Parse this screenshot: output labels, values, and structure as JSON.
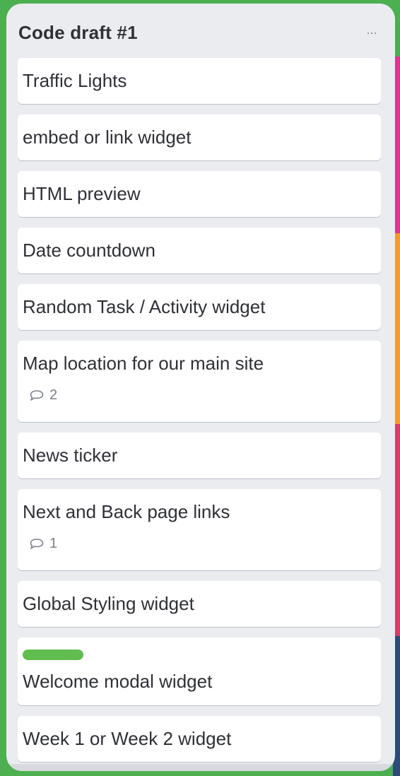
{
  "list": {
    "title": "Code draft #1",
    "menu_icon": "more-horizontal-icon",
    "menu_glyph": "···"
  },
  "cards": [
    {
      "title": "Traffic Lights"
    },
    {
      "title": "embed or link widget"
    },
    {
      "title": "HTML preview"
    },
    {
      "title": "Date countdown"
    },
    {
      "title": "Random Task / Activity widget"
    },
    {
      "title": "Map location for our main site",
      "comments": "2",
      "comment_icon": "comment-icon"
    },
    {
      "title": "News ticker"
    },
    {
      "title": "Next and Back page links",
      "comments": "1",
      "comment_icon": "comment-icon"
    },
    {
      "title": "Global Styling widget"
    },
    {
      "title": "Welcome modal widget",
      "label_color": "#61bd4f"
    },
    {
      "title": "Week 1 or Week 2 widget"
    }
  ],
  "colors": {
    "board_background": "#4caf50",
    "list_background": "#ebecf0",
    "card_background": "#ffffff",
    "label_green": "#61bd4f"
  }
}
